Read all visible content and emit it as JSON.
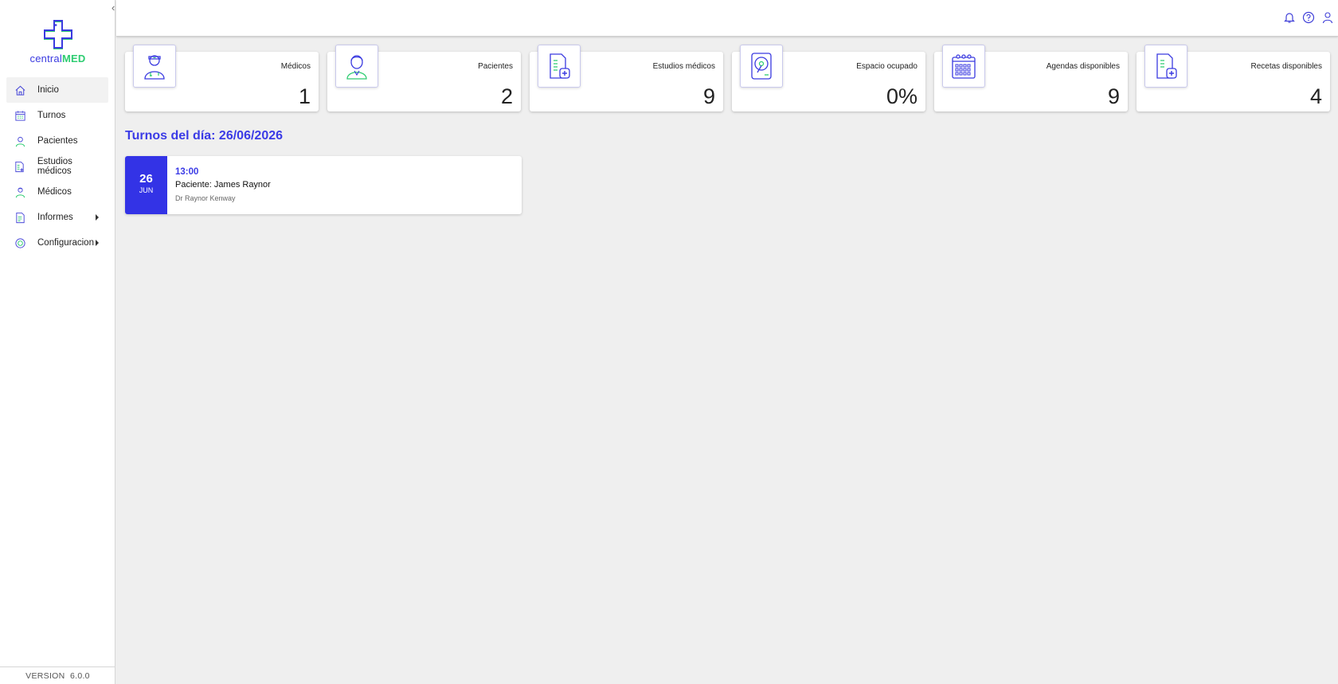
{
  "logo": {
    "text_central": "central",
    "text_med": "MED"
  },
  "sidebar": {
    "collapse_glyph": "‹",
    "items": [
      {
        "label": "Inicio",
        "icon": "home-icon",
        "active": true
      },
      {
        "label": "Turnos",
        "icon": "calendar-icon"
      },
      {
        "label": "Pacientes",
        "icon": "patient-icon"
      },
      {
        "label": "Estudios médicos",
        "icon": "document-icon"
      },
      {
        "label": "Médicos",
        "icon": "doctor-icon"
      },
      {
        "label": "Informes",
        "icon": "report-icon",
        "has_submenu": true
      },
      {
        "label": "Configuracion",
        "icon": "settings-icon",
        "has_submenu": true
      }
    ],
    "version_label": "VERSION",
    "version_value": "6.0.0"
  },
  "topbar": {
    "icons": [
      "bell-icon",
      "help-icon",
      "user-icon"
    ]
  },
  "cards": [
    {
      "label": "Médicos",
      "value": "1",
      "icon": "doctor-icon"
    },
    {
      "label": "Pacientes",
      "value": "2",
      "icon": "patient-icon"
    },
    {
      "label": "Estudios médicos",
      "value": "9",
      "icon": "medical-study-icon"
    },
    {
      "label": "Espacio ocupado",
      "value": "0%",
      "icon": "hard-drive-icon"
    },
    {
      "label": "Agendas disponibles",
      "value": "9",
      "icon": "calendar-icon"
    },
    {
      "label": "Recetas disponibles",
      "value": "4",
      "icon": "prescription-icon"
    }
  ],
  "today": {
    "title": "Turnos del día: 26/06/2026",
    "appointments": [
      {
        "day": "26",
        "month": "JUN",
        "time": "13:00",
        "patient": "Paciente: James Raynor",
        "doctor": "Dr Raynor Kenway"
      }
    ]
  },
  "colors": {
    "accent": "#3333e6",
    "brand_green": "#2ecc71",
    "background": "#efefef"
  }
}
